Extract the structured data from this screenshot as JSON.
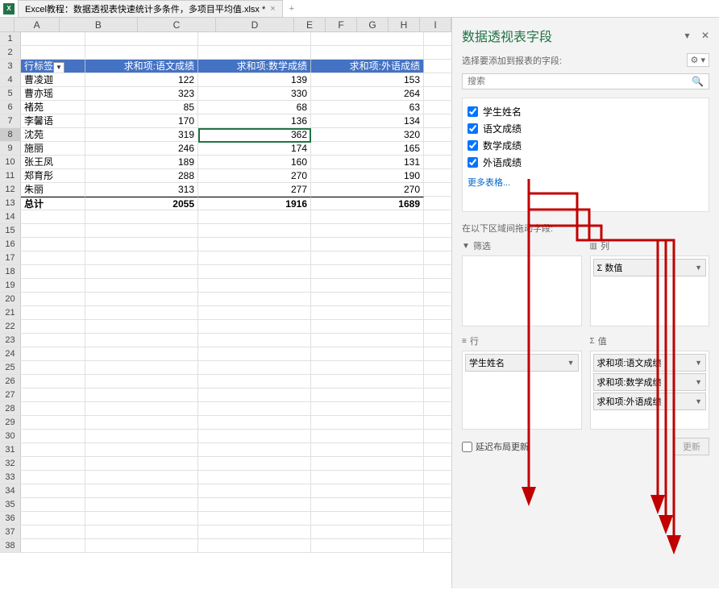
{
  "titlebar": {
    "filename": "Excel教程：数据透视表快速统计多条件，多项目平均值.xlsx *"
  },
  "columns": [
    "A",
    "B",
    "C",
    "D",
    "E",
    "F",
    "G",
    "H",
    "I"
  ],
  "pivot_headers": {
    "rowlabel": "行标签",
    "b": "求和项:语文成绩",
    "c": "求和项:数学成绩",
    "d": "求和项:外语成绩"
  },
  "rows": [
    {
      "name": "曹凌迦",
      "b": 122,
      "c": 139,
      "d": 153
    },
    {
      "name": "曹亦瑶",
      "b": 323,
      "c": 330,
      "d": 264
    },
    {
      "name": "褚苑",
      "b": 85,
      "c": 68,
      "d": 63
    },
    {
      "name": "李馨语",
      "b": 170,
      "c": 136,
      "d": 134
    },
    {
      "name": "沈苑",
      "b": 319,
      "c": 362,
      "d": 320
    },
    {
      "name": "施丽",
      "b": 246,
      "c": 174,
      "d": 165
    },
    {
      "name": "张王凤",
      "b": 189,
      "c": 160,
      "d": 131
    },
    {
      "name": "郑育彤",
      "b": 288,
      "c": 270,
      "d": 190
    },
    {
      "name": "朱丽",
      "b": 313,
      "c": 277,
      "d": 270
    }
  ],
  "totals": {
    "label": "总计",
    "b": 2055,
    "c": 1916,
    "d": 1689
  },
  "pane": {
    "title": "数据透视表字段",
    "subtitle": "选择要添加到报表的字段:",
    "search_placeholder": "搜索",
    "fields": [
      "学生姓名",
      "语文成绩",
      "数学成绩",
      "外语成绩"
    ],
    "more": "更多表格...",
    "drag_label": "在以下区域间拖动字段:",
    "areas": {
      "filter": "筛选",
      "columns": "列",
      "rows": "行",
      "values": "值",
      "col_items": [
        "Σ 数值"
      ],
      "row_items": [
        "学生姓名"
      ],
      "val_items": [
        "求和项:语文成绩",
        "求和项:数学成绩",
        "求和项:外语成绩"
      ]
    },
    "defer": "延迟布局更新",
    "update": "更新"
  },
  "chart_data": {
    "type": "table",
    "title": "数据透视表",
    "columns": [
      "行标签",
      "求和项:语文成绩",
      "求和项:数学成绩",
      "求和项:外语成绩"
    ],
    "rows": [
      [
        "曹凌迦",
        122,
        139,
        153
      ],
      [
        "曹亦瑶",
        323,
        330,
        264
      ],
      [
        "褚苑",
        85,
        68,
        63
      ],
      [
        "李馨语",
        170,
        136,
        134
      ],
      [
        "沈苑",
        319,
        362,
        320
      ],
      [
        "施丽",
        246,
        174,
        165
      ],
      [
        "张王凤",
        189,
        160,
        131
      ],
      [
        "郑育彤",
        288,
        270,
        190
      ],
      [
        "朱丽",
        313,
        277,
        270
      ],
      [
        "总计",
        2055,
        1916,
        1689
      ]
    ]
  }
}
